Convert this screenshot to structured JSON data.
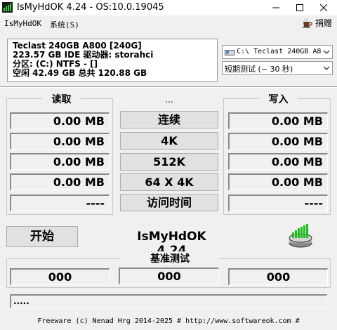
{
  "window": {
    "title": "IsMyHdOK 4.24 - OS:10.0.19045"
  },
  "menu": {
    "app": "IsMyHdOK",
    "system": "系统(S)",
    "donate": "捐赠"
  },
  "drive_info": {
    "line1": "Teclast 240GB A800 [240G]",
    "line2": "223.57 GB  IDE 驱动器: storahci",
    "line3": "分区: (C:) NTFS - []",
    "line4": "空闲 42.49 GB 总共 120.88 GB"
  },
  "drive_select": {
    "value": "C:\\ Teclast 240GB A8"
  },
  "test_select": {
    "value": "短期测试 (~ 30 秒)"
  },
  "read": {
    "label": "读取",
    "values": [
      "0.00 MB",
      "0.00 MB",
      "0.00 MB",
      "0.00 MB",
      "----"
    ]
  },
  "write": {
    "label": "写入",
    "values": [
      "0.00 MB",
      "0.00 MB",
      "0.00 MB",
      "0.00 MB",
      "----"
    ]
  },
  "middle": {
    "label": "...",
    "buttons": [
      "连续",
      "4K",
      "512K",
      "64 X 4K",
      "访问时间"
    ]
  },
  "start_label": "开始",
  "app_name": "IsMyHdOK 4.24",
  "benchmark": {
    "label": "基准测试",
    "values": [
      "000",
      "000",
      "000"
    ]
  },
  "status_text": ".....",
  "footer": "Freeware (c) Nenad Hrg 2014-2025 # http://www.softwareok.com    #"
}
